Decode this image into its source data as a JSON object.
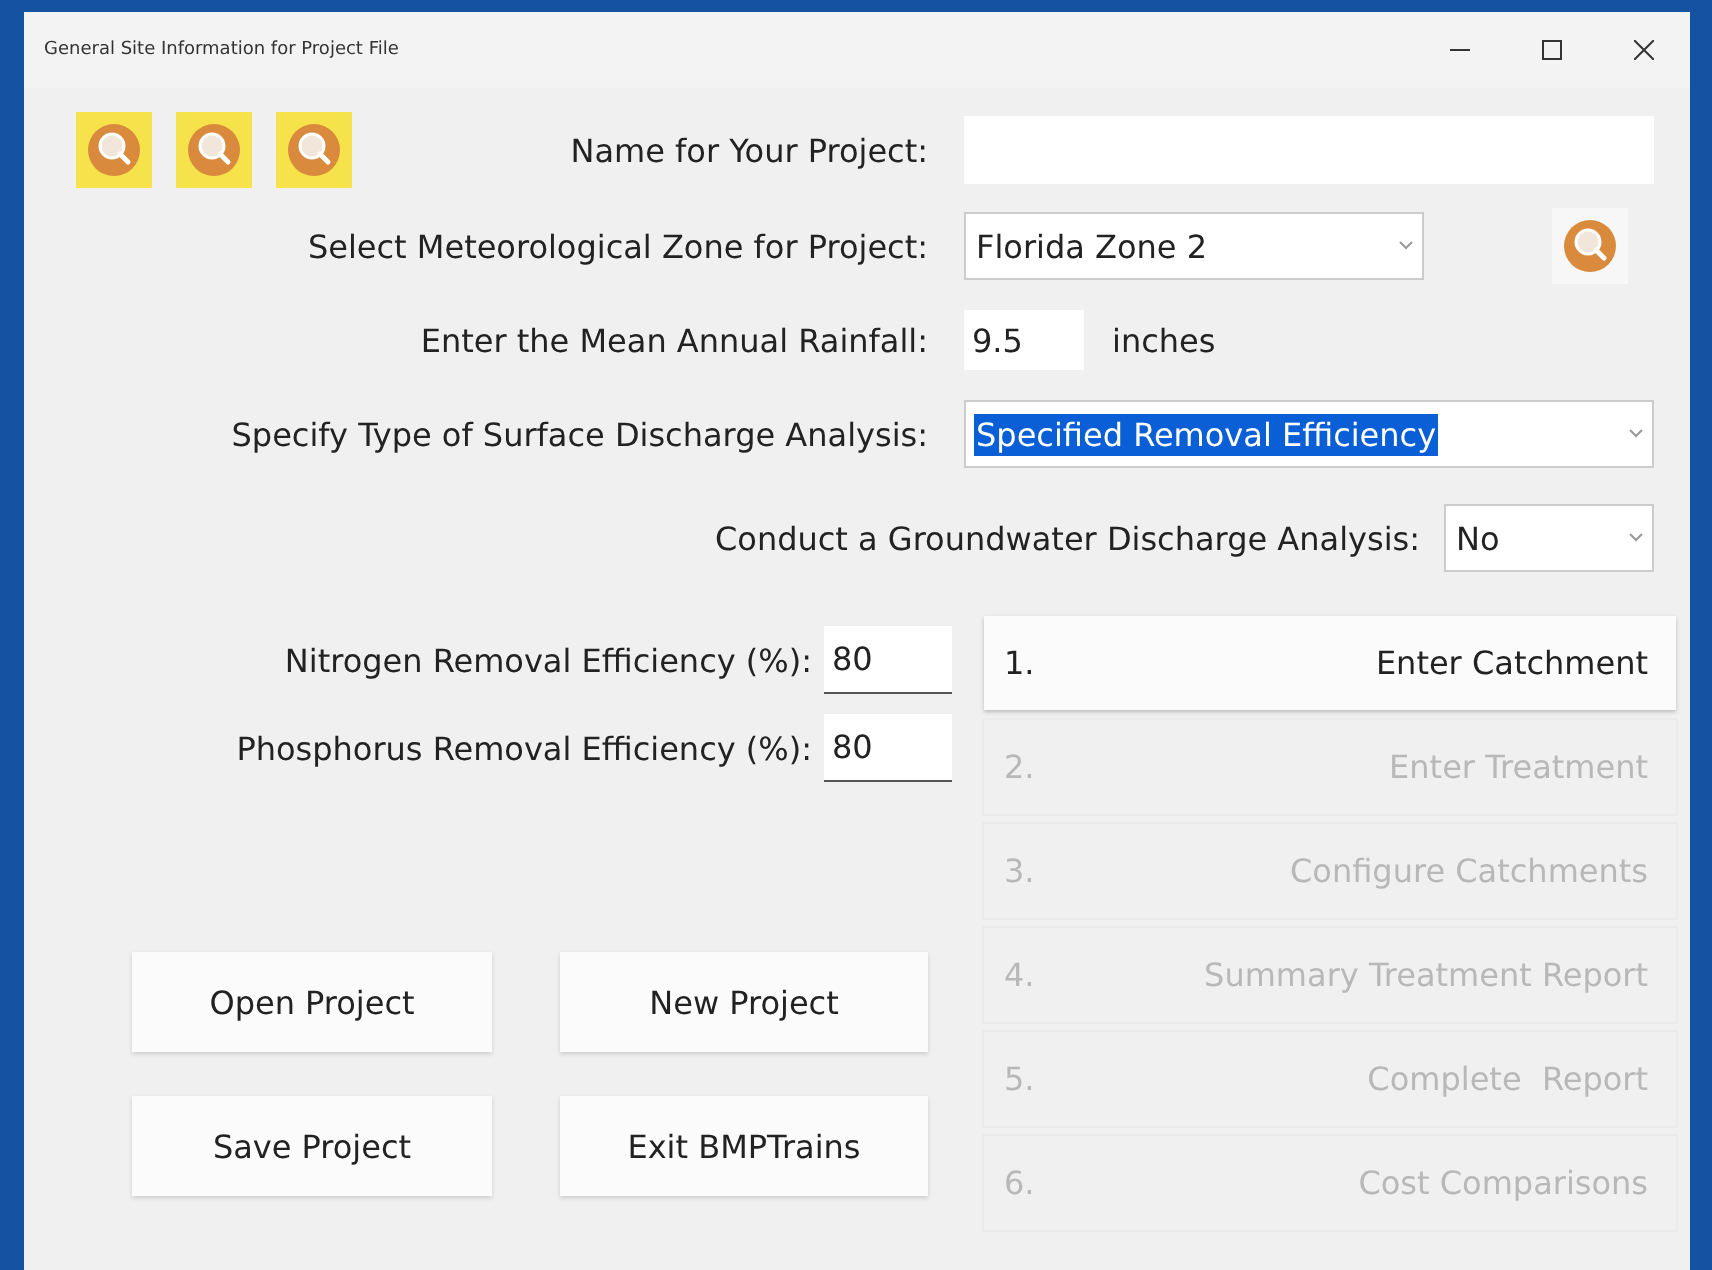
{
  "window": {
    "title": "General Site Information for Project File"
  },
  "lookup_buttons": [
    {
      "kind": "search"
    },
    {
      "kind": "search"
    },
    {
      "kind": "search"
    }
  ],
  "project_name": {
    "label": "Name for Your Project:"
  },
  "zone": {
    "label": "Select Meteorological Zone for Project:",
    "value": "Florida Zone 2"
  },
  "rainfall": {
    "label": "Enter the Mean Annual Rainfall:",
    "value": "9.5",
    "unit": "inches"
  },
  "surface_analysis": {
    "label": "Specify Type of Surface Discharge Analysis:",
    "value": "Specified Removal Efficiency",
    "selected": true
  },
  "groundwater_analysis": {
    "label": "Conduct a Groundwater Discharge Analysis:",
    "value": "No",
    "selected": false
  },
  "efficiencies": [
    {
      "label": "Nitrogen Removal Efficiency (%):",
      "value": "80"
    },
    {
      "label": "Phosphorus Removal Efficiency (%):",
      "value": "80"
    }
  ],
  "steps": [
    {
      "number": "1.",
      "label": "Enter Catchment",
      "disabled": false
    },
    {
      "number": "2.",
      "label": "Enter Treatment",
      "disabled": true
    },
    {
      "number": "3.",
      "label": "Configure Catchments",
      "disabled": true
    },
    {
      "number": "4.",
      "label": "Summary Treatment Report",
      "disabled": true
    },
    {
      "number": "5.",
      "label": "Complete  Report",
      "disabled": true
    },
    {
      "number": "6.",
      "label": "Cost Comparisons",
      "disabled": true
    }
  ],
  "project_buttons": [
    "Open Project",
    "New Project",
    "Save Project",
    "Exit BMPTrains"
  ]
}
